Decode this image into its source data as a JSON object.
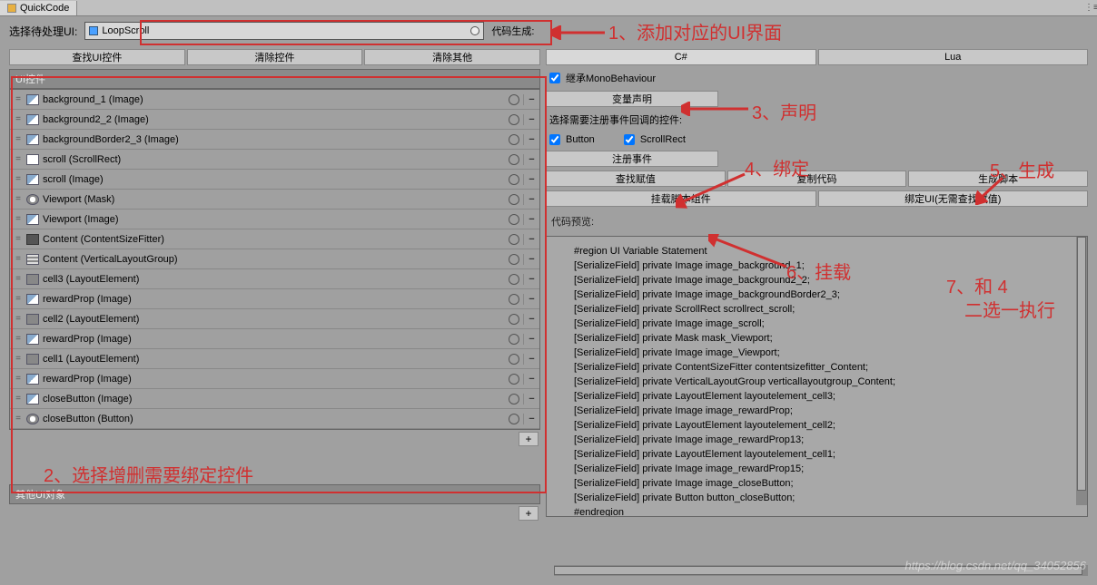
{
  "window": {
    "title": "QuickCode"
  },
  "select_row": {
    "label": "选择待处理UI:",
    "value": "LoopScroll",
    "hint": "代码生成:"
  },
  "left_buttons": [
    "查找UI控件",
    "清除控件",
    "清除其他"
  ],
  "ui_section": {
    "header": "UI控件"
  },
  "ui_items": [
    {
      "label": "background_1 (Image)",
      "icon": "img"
    },
    {
      "label": "background2_2 (Image)",
      "icon": "img"
    },
    {
      "label": "backgroundBorder2_3 (Image)",
      "icon": "img"
    },
    {
      "label": "scroll (ScrollRect)",
      "icon": "rect"
    },
    {
      "label": "scroll (Image)",
      "icon": "img"
    },
    {
      "label": "Viewport (Mask)",
      "icon": "mask"
    },
    {
      "label": "Viewport (Image)",
      "icon": "img"
    },
    {
      "label": "Content (ContentSizeFitter)",
      "icon": "fit"
    },
    {
      "label": "Content (VerticalLayoutGroup)",
      "icon": "layout"
    },
    {
      "label": "cell3 (LayoutElement)",
      "icon": "elem"
    },
    {
      "label": "rewardProp (Image)",
      "icon": "img"
    },
    {
      "label": "cell2 (LayoutElement)",
      "icon": "elem"
    },
    {
      "label": "rewardProp (Image)",
      "icon": "img"
    },
    {
      "label": "cell1 (LayoutElement)",
      "icon": "elem"
    },
    {
      "label": "rewardProp (Image)",
      "icon": "img"
    },
    {
      "label": "closeButton (Image)",
      "icon": "img"
    },
    {
      "label": "closeButton (Button)",
      "icon": "mask"
    }
  ],
  "other_section": {
    "header": "其他UI对象"
  },
  "right": {
    "tabs": [
      "C#",
      "Lua"
    ],
    "mono_label": "继承MonoBehaviour",
    "var_decl": "变量声明",
    "callback_label": "选择需要注册事件回调的控件:",
    "cb_button": "Button",
    "cb_scrollrect": "ScrollRect",
    "register": "注册事件",
    "row3": [
      "查找赋值",
      "复制代码",
      "生成脚本"
    ],
    "row4": [
      "挂载脚本组件",
      "绑定UI(无需查找赋值)"
    ],
    "preview_label": "代码预览:"
  },
  "code_lines": [
    "#region UI Variable Statement",
    "[SerializeField] private Image image_background_1;",
    "[SerializeField] private Image image_background2_2;",
    "[SerializeField] private Image image_backgroundBorder2_3;",
    "[SerializeField] private ScrollRect scrollrect_scroll;",
    "[SerializeField] private Image image_scroll;",
    "[SerializeField] private Mask mask_Viewport;",
    "[SerializeField] private Image image_Viewport;",
    "[SerializeField] private ContentSizeFitter contentsizefitter_Content;",
    "[SerializeField] private VerticalLayoutGroup verticallayoutgroup_Content;",
    "[SerializeField] private LayoutElement layoutelement_cell3;",
    "[SerializeField] private Image image_rewardProp;",
    "[SerializeField] private LayoutElement layoutelement_cell2;",
    "[SerializeField] private Image image_rewardProp13;",
    "[SerializeField] private LayoutElement layoutelement_cell1;",
    "[SerializeField] private Image image_rewardProp15;",
    "[SerializeField] private Image image_closeButton;",
    "[SerializeField] private Button button_closeButton;",
    "#endregion"
  ],
  "annotations": {
    "a1": "1、添加对应的UI界面",
    "a2": "2、选择增删需要绑定控件",
    "a3": "3、声明",
    "a4": "4、绑定",
    "a5": "5、生成",
    "a6": "6、挂载",
    "a7a": "7、和 4",
    "a7b": "二选一执行"
  },
  "watermark": "https://blog.csdn.net/qq_34052856"
}
